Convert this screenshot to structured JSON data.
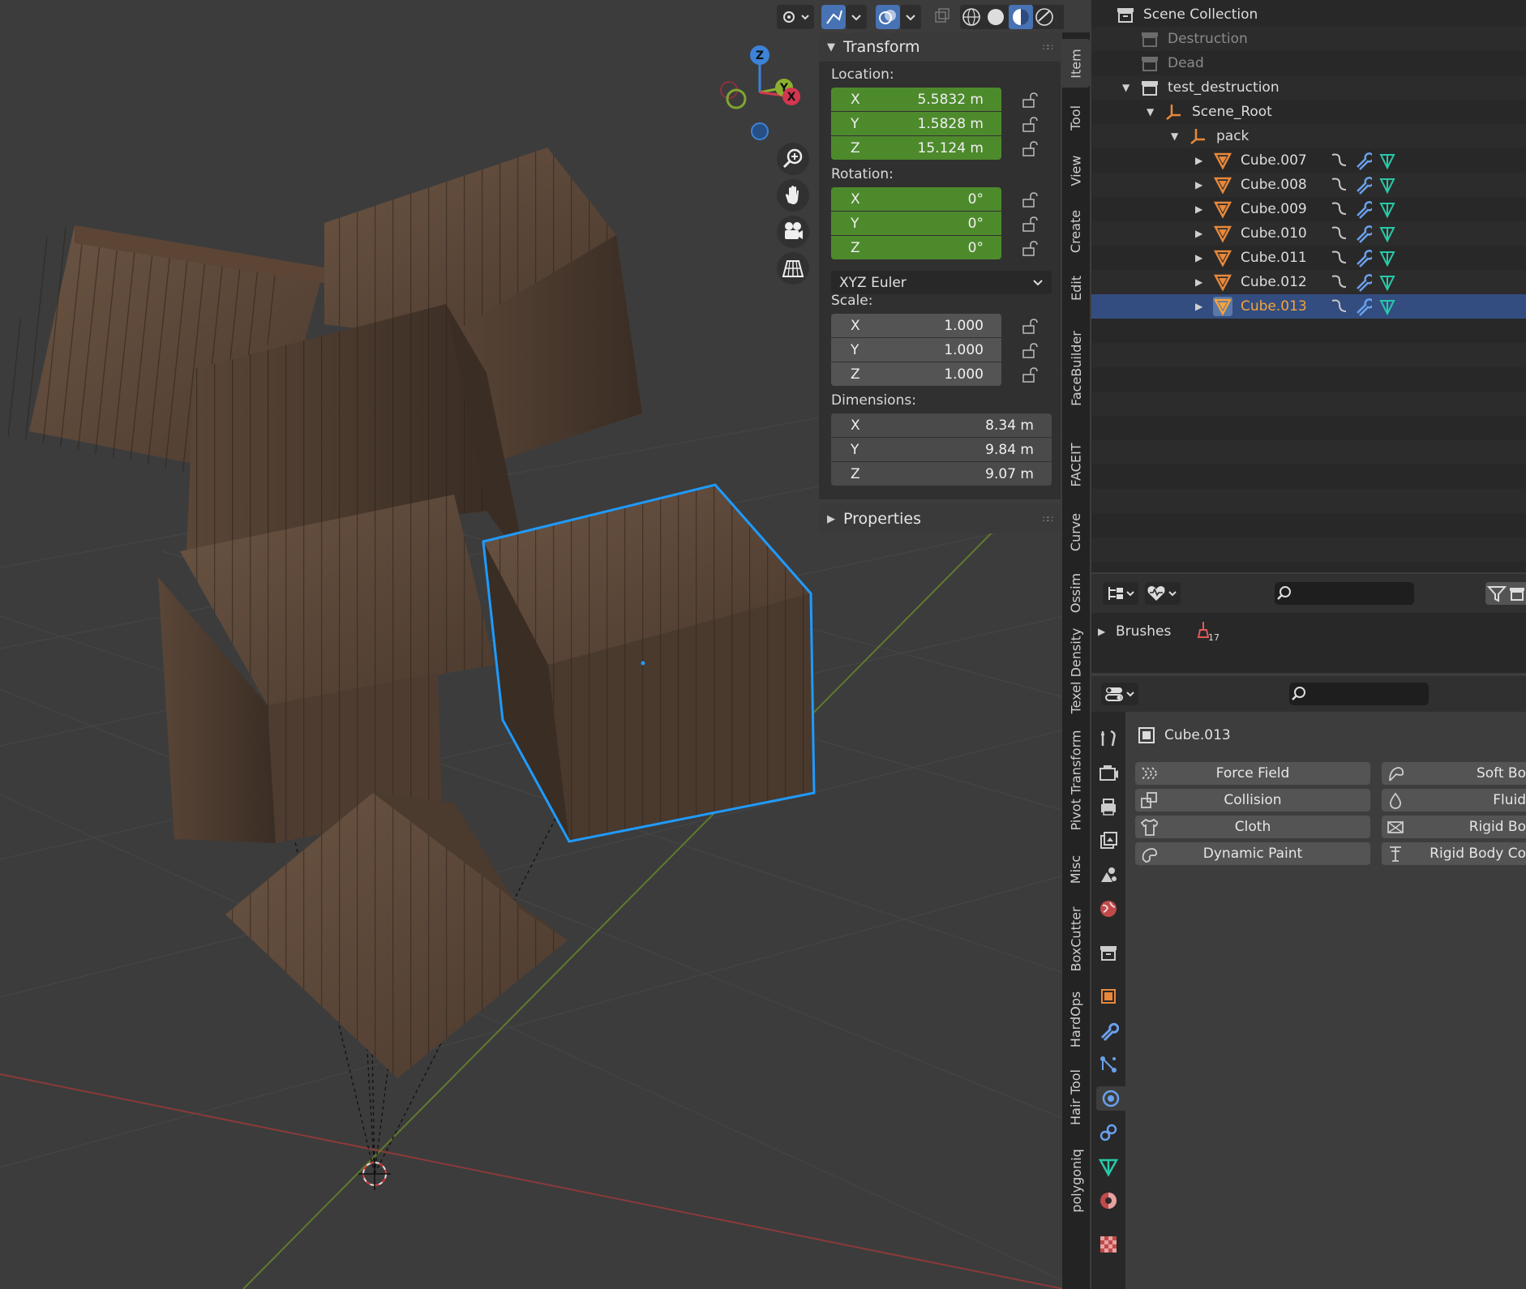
{
  "viewport": {
    "gizmo": {
      "z": "Z",
      "y": "Y",
      "x": "X"
    },
    "header_icons": [
      "visibility-icon",
      "gizmo-toggle-icon",
      "overlay-icon",
      "xray-icon",
      "wireframe-shading-icon",
      "solid-shading-icon",
      "material-shading-icon",
      "rendered-shading-icon"
    ],
    "nav_icons": [
      "zoom-icon",
      "pan-hand-icon",
      "camera-view-icon",
      "perspective-grid-icon"
    ]
  },
  "transform_panel": {
    "title": "Transform",
    "location_label": "Location:",
    "location": [
      {
        "axis": "X",
        "value": "5.5832 m"
      },
      {
        "axis": "Y",
        "value": "1.5828 m"
      },
      {
        "axis": "Z",
        "value": "15.124 m"
      }
    ],
    "rotation_label": "Rotation:",
    "rotation": [
      {
        "axis": "X",
        "value": "0°"
      },
      {
        "axis": "Y",
        "value": "0°"
      },
      {
        "axis": "Z",
        "value": "0°"
      }
    ],
    "rotation_mode": "XYZ Euler",
    "scale_label": "Scale:",
    "scale": [
      {
        "axis": "X",
        "value": "1.000"
      },
      {
        "axis": "Y",
        "value": "1.000"
      },
      {
        "axis": "Z",
        "value": "1.000"
      }
    ],
    "dimensions_label": "Dimensions:",
    "dimensions": [
      {
        "axis": "X",
        "value": "8.34 m"
      },
      {
        "axis": "Y",
        "value": "9.84 m"
      },
      {
        "axis": "Z",
        "value": "9.07 m"
      }
    ]
  },
  "properties_panel": {
    "title": "Properties"
  },
  "sidebar_tabs": [
    "Item",
    "Tool",
    "View",
    "Create",
    "Edit",
    "FaceBuilder",
    "FACEIT",
    "Curve",
    "Ossim",
    "Texel Density",
    "Pivot Transform",
    "Misc",
    "BoxCutter",
    "HardOps",
    "Hair Tool",
    "polygoniq"
  ],
  "outliner": {
    "root": "Scene Collection",
    "items": [
      {
        "label": "Destruction",
        "kind": "collection",
        "depth": 1,
        "excluded": true
      },
      {
        "label": "Dead",
        "kind": "collection",
        "depth": 1,
        "excluded": true
      },
      {
        "label": "test_destruction",
        "kind": "collection",
        "depth": 1,
        "expanded": true
      },
      {
        "label": "Scene_Root",
        "kind": "empty",
        "depth": 2,
        "expanded": true
      },
      {
        "label": "pack",
        "kind": "empty",
        "depth": 3,
        "expanded": true
      },
      {
        "label": "Cube.007",
        "kind": "mesh",
        "depth": 4
      },
      {
        "label": "Cube.008",
        "kind": "mesh",
        "depth": 4
      },
      {
        "label": "Cube.009",
        "kind": "mesh",
        "depth": 4
      },
      {
        "label": "Cube.010",
        "kind": "mesh",
        "depth": 4
      },
      {
        "label": "Cube.011",
        "kind": "mesh",
        "depth": 4
      },
      {
        "label": "Cube.012",
        "kind": "mesh",
        "depth": 4
      },
      {
        "label": "Cube.013",
        "kind": "mesh",
        "depth": 4,
        "selected": true
      }
    ]
  },
  "browser": {
    "item": "Brushes",
    "badge": "17"
  },
  "properties": {
    "object_name": "Cube.013",
    "buttons_left": [
      "Force Field",
      "Collision",
      "Cloth",
      "Dynamic Paint"
    ],
    "buttons_right": [
      "Soft Bo",
      "Fluid",
      "Rigid Bo",
      "Rigid Body Co"
    ],
    "tabs": [
      "tool-icon",
      "render-icon",
      "output-icon",
      "view-layer-icon",
      "scene-icon",
      "world-icon",
      "collection-icon",
      "object-icon",
      "modifier-icon",
      "particles-icon",
      "physics-icon",
      "constraints-icon",
      "data-icon",
      "material-icon",
      "texture-icon"
    ]
  },
  "colors": {
    "accent": "#4772b3",
    "selected_outline": "#1f9bff",
    "field_green": "#4d8a2c",
    "highlight_orange": "#f5a33a",
    "mesh_teal": "#27c9a8"
  }
}
